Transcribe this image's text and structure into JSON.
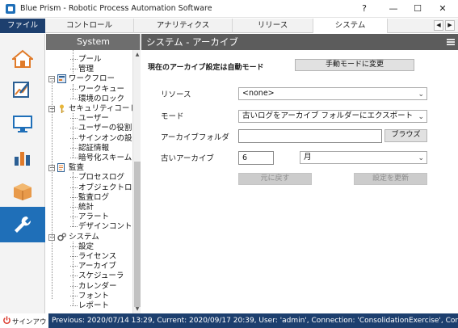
{
  "window": {
    "title": "Blue Prism - Robotic Process Automation Software",
    "help": "?",
    "minimize": "—",
    "maximize": "☐",
    "close": "✕"
  },
  "nav": {
    "file": "ファイル",
    "tabs": [
      "コントロール",
      "アナリティクス",
      "リリース",
      "システム"
    ],
    "active_tab": "システム",
    "scroll_left": "◀",
    "scroll_right": "▶"
  },
  "rail": {
    "items": [
      "home-icon",
      "studio-icon",
      "control-icon",
      "analytics-icon",
      "release-icon",
      "system-icon"
    ],
    "active": "system-icon",
    "signout": "サインアウト"
  },
  "tree": {
    "header": "System",
    "pre_items": [
      "プール",
      "管理"
    ],
    "groups": [
      {
        "label": "ワークフロー",
        "icon": "workflow-icon",
        "items": [
          "ワークキュー",
          "環境のロック"
        ]
      },
      {
        "label": "セキュリティコード",
        "icon": "key-icon",
        "items": [
          "ユーザー",
          "ユーザーの役割",
          "サインオンの設定",
          "認証情報",
          "暗号化スキーム"
        ]
      },
      {
        "label": "監査",
        "icon": "audit-icon",
        "items": [
          "プロセスログ",
          "オブジェクトログ",
          "監査ログ",
          "統計",
          "アラート",
          "デザインコントロール"
        ]
      },
      {
        "label": "システム",
        "icon": "system-gear-icon",
        "items": [
          "設定",
          "ライセンス",
          "アーカイブ",
          "スケジューラ",
          "カレンダー",
          "フォント",
          "レポート"
        ]
      }
    ]
  },
  "content": {
    "header": "システム - アーカイブ",
    "mode_text": "現在のアーカイブ設定は自動モード",
    "manual_button": "手動モードに変更",
    "resource_label": "リソース",
    "resource_value": "<none>",
    "mode_label": "モード",
    "mode_value": "古いログをアーカイブ フォルダーにエクスポート",
    "folder_label": "アーカイブフォルダ",
    "folder_value": "",
    "browse_button": "ブラウズ",
    "old_archive_label": "古いアーカイブ",
    "old_archive_number": "6",
    "old_archive_unit": "月",
    "revert_button": "元に戻す",
    "update_button": "設定を更新"
  },
  "status": {
    "text": "Previous: 2020/07/14 13:29, Current: 2020/09/17 20:39, User: 'admin', Connection: 'ConsolidationExercise', Connected To: 'SQL Se"
  },
  "colors": {
    "accent_blue": "#1f6fb8",
    "status_bar": "#1d3f6e",
    "tree_header": "#6e6e6e",
    "content_header": "#5c5c5c"
  }
}
